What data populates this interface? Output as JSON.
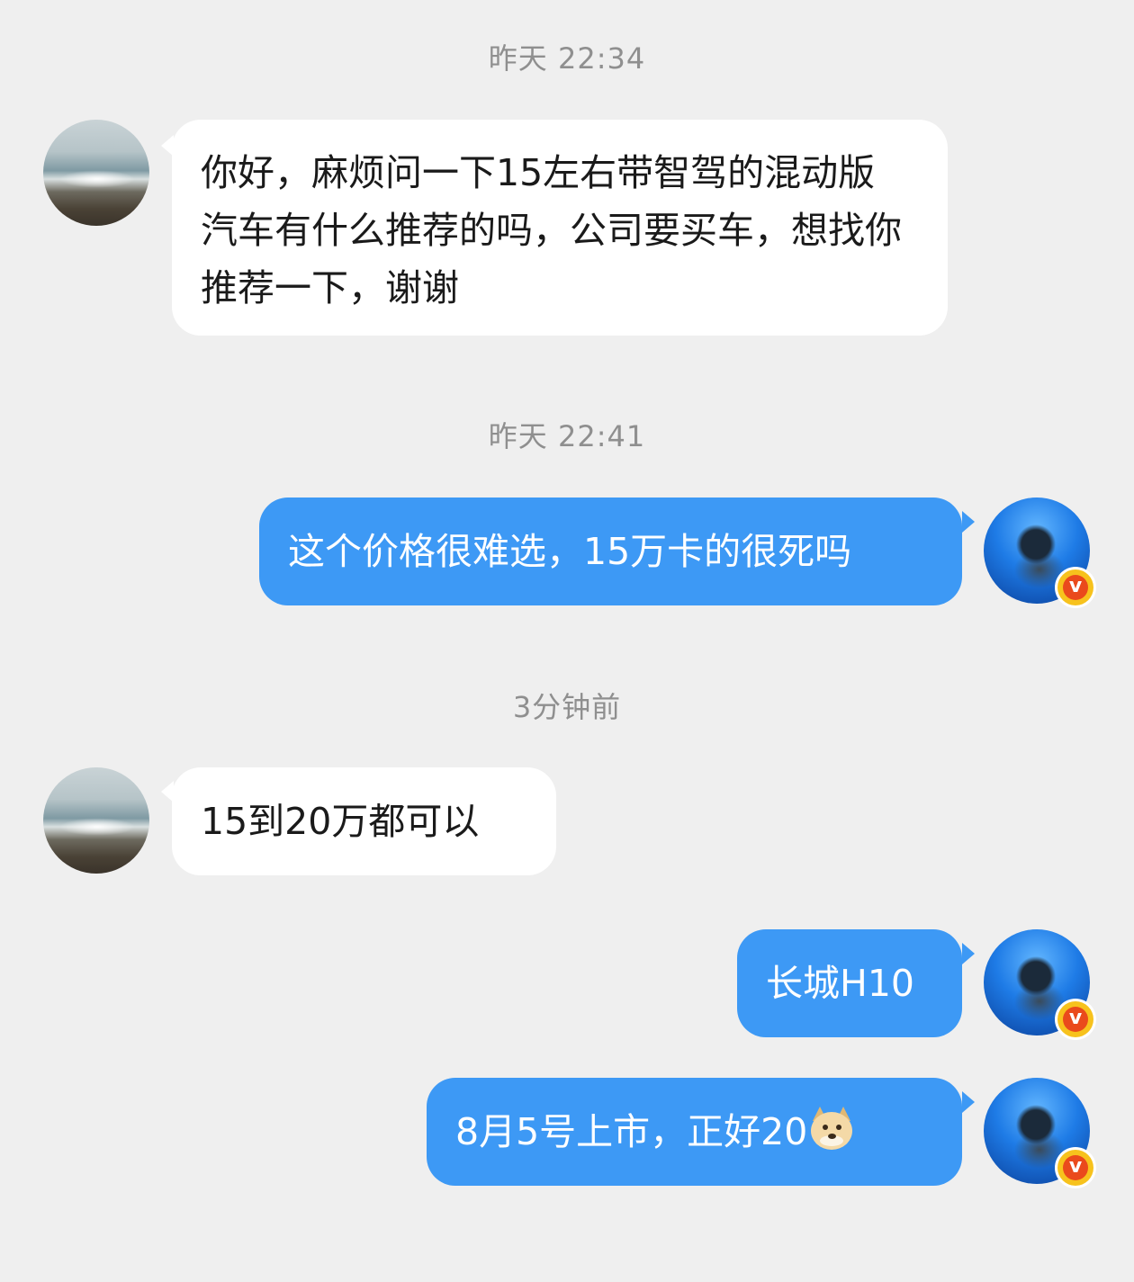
{
  "timestamps": [
    "昨天 22:34",
    "昨天 22:41",
    "3分钟前"
  ],
  "messages": [
    {
      "side": "left",
      "text": "你好，麻烦问一下15左右带智驾的混动版汽车有什么推荐的吗，公司要买车，想找你推荐一下，谢谢"
    },
    {
      "side": "right",
      "text": "这个价格很难选，15万卡的很死吗"
    },
    {
      "side": "left",
      "text": "15到20万都可以"
    },
    {
      "side": "right",
      "text": "长城H10"
    },
    {
      "side": "right",
      "text": "8月5号上市，正好20",
      "emoji": "doge-emoji"
    }
  ],
  "badge": {
    "label": "v"
  },
  "colors": {
    "background": "#efefef",
    "bubble_left": "#ffffff",
    "bubble_right": "#3d99f5",
    "timestamp": "#8f8f8f",
    "badge_outer": "#f7c21d",
    "badge_inner": "#ea4a1c"
  }
}
